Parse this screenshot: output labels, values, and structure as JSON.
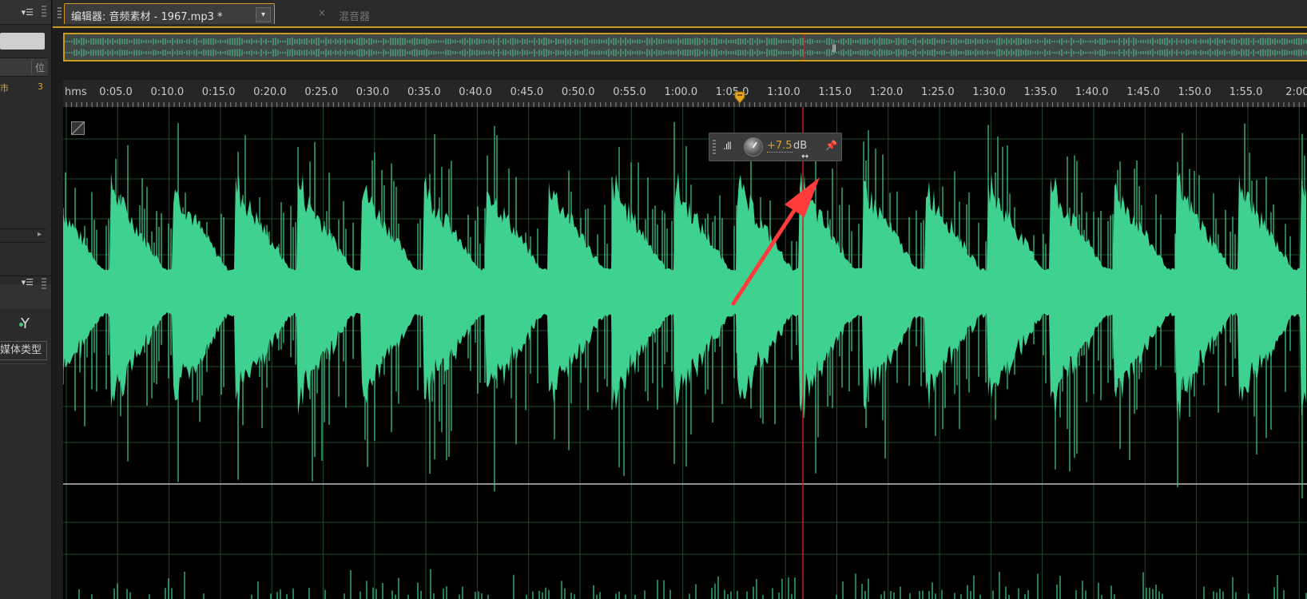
{
  "left_panel": {
    "menu_icon": "▾☰",
    "column_header": "位",
    "row_left": "市",
    "row_right": "3",
    "scroll_arrow": "▸",
    "panel2_menu_icon": "▾☰",
    "filter_icon": "Y",
    "media_type_label": "媒体类型"
  },
  "tabs": {
    "editor_label": "编辑器: 音频素材 - 1967.mp3 *",
    "dropdown_icon": "▾",
    "close_icon": "×",
    "mixer_label": "混音器"
  },
  "overview": {
    "handle_icon": "|||"
  },
  "ruler": {
    "unit": "hms",
    "ticks": [
      "0:05.0",
      "0:10.0",
      "0:15.0",
      "0:20.0",
      "0:25.0",
      "0:30.0",
      "0:35.0",
      "0:40.0",
      "0:45.0",
      "0:50.0",
      "0:55.0",
      "1:00.0",
      "1:05.0",
      "1:10.0",
      "1:15.0",
      "1:20.0",
      "1:25.0",
      "1:30.0",
      "1:35.0",
      "1:40.0",
      "1:45.0",
      "1:50.0",
      "1:55.0",
      "2:00"
    ]
  },
  "hud": {
    "meter_icon": ".ıll",
    "value": "+7.5",
    "unit": "dB",
    "pin_icon": "📌",
    "cursor_icon": "↔"
  },
  "colors": {
    "waveform": "#3fd18f",
    "playhead": "#c8201c",
    "accent": "#c99a1e",
    "annotation_arrow": "#ff3b3b",
    "grid": "#1e4a2a"
  }
}
